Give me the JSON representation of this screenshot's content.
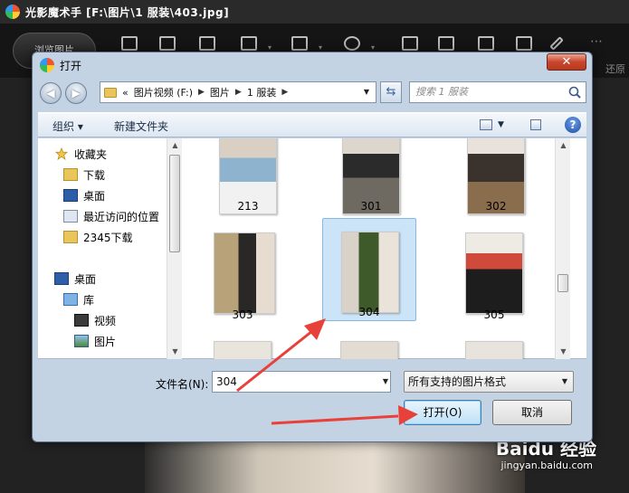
{
  "app": {
    "title": "光影魔术手 [F:\\图片\\1 服装\\403.jpg]",
    "browse_label": "浏览图片",
    "undo_label": "还原"
  },
  "dialog": {
    "title": "打开",
    "close_label": "✕",
    "breadcrumb": [
      "«",
      "图片视频 (F:)",
      "图片",
      "1 服装"
    ],
    "search_placeholder": "搜索 1 服装",
    "toolbar": {
      "organize": "组织 ▾",
      "new_folder": "新建文件夹",
      "help": "?"
    },
    "sidebar": [
      {
        "label": "收藏夹",
        "icon": "star-icon"
      },
      {
        "label": "下载",
        "icon": "download-folder-icon"
      },
      {
        "label": "桌面",
        "icon": "desktop-icon"
      },
      {
        "label": "最近访问的位置",
        "icon": "recent-places-icon"
      },
      {
        "label": "2345下载",
        "icon": "folder-icon"
      },
      {
        "label": "桌面",
        "icon": "desktop-icon"
      },
      {
        "label": "库",
        "icon": "library-icon"
      },
      {
        "label": "视频",
        "icon": "video-library-icon"
      },
      {
        "label": "图片",
        "icon": "picture-library-icon"
      }
    ],
    "files": [
      "213",
      "301",
      "302",
      "303",
      "304",
      "305"
    ],
    "selected_file": "304",
    "filename_label": "文件名(N):",
    "filename_value": "304",
    "filetype": "所有支持的图片格式",
    "open_label": "打开(O)",
    "cancel_label": "取消"
  },
  "watermark": {
    "brand": "Baidu 经验",
    "url": "jingyan.baidu.com"
  },
  "colors": {
    "annotation_arrow": "#e8413a",
    "selection": "#cce4f7",
    "dialog_frame": "#c4d3e4"
  }
}
